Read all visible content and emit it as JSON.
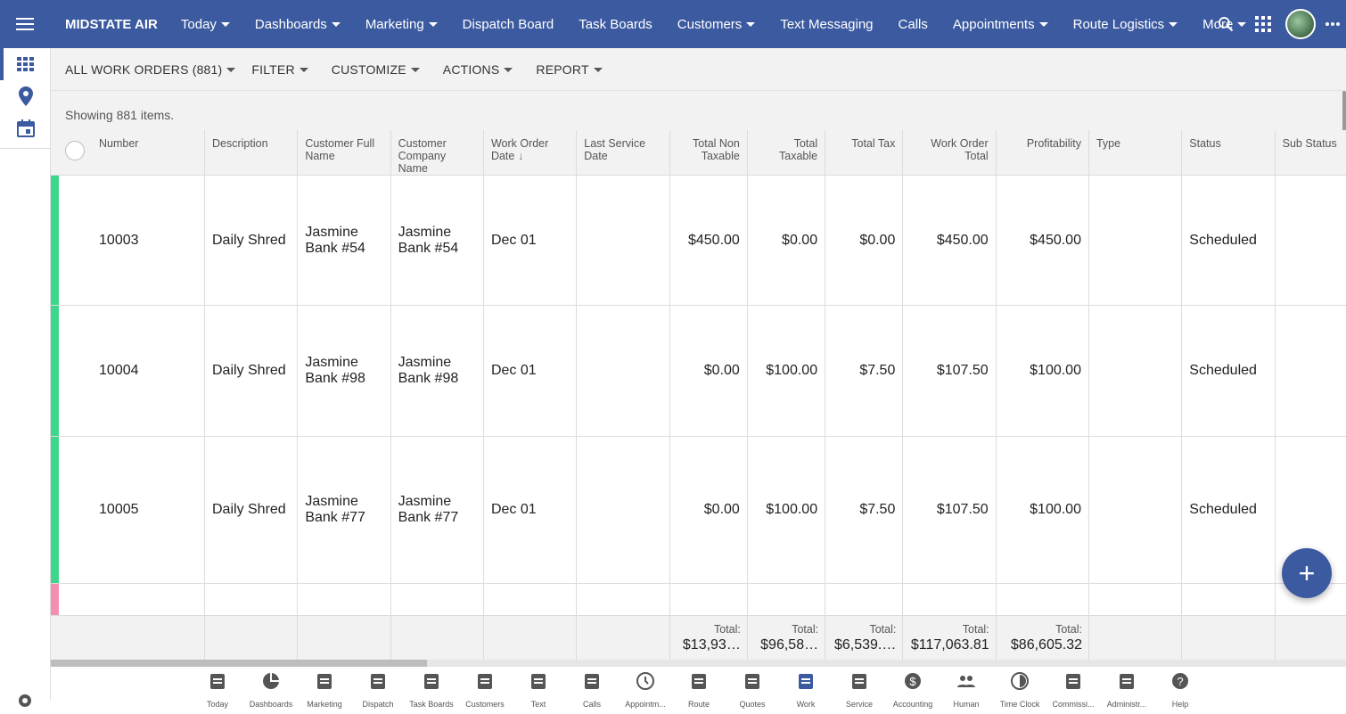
{
  "brand": "MIDSTATE AIR",
  "nav": [
    {
      "label": "Today",
      "caret": true
    },
    {
      "label": "Dashboards",
      "caret": true
    },
    {
      "label": "Marketing",
      "caret": true
    },
    {
      "label": "Dispatch Board",
      "caret": false
    },
    {
      "label": "Task Boards",
      "caret": false
    },
    {
      "label": "Customers",
      "caret": true
    },
    {
      "label": "Text Messaging",
      "caret": false
    },
    {
      "label": "Calls",
      "caret": false
    },
    {
      "label": "Appointments",
      "caret": true
    },
    {
      "label": "Route Logistics",
      "caret": true
    },
    {
      "label": "More",
      "caret": true
    }
  ],
  "nav_icons": [
    "search-icon",
    "apps-grid-icon",
    "avatar",
    "more-horizontal-icon"
  ],
  "rail_icons": [
    "grid-view-icon",
    "map-pin-icon",
    "calendar-icon"
  ],
  "toolbar": {
    "view": "ALL WORK ORDERS (881)",
    "filter": "FILTER",
    "customize": "CUSTOMIZE",
    "actions": "ACTIONS",
    "report": "REPORT"
  },
  "summary": "Showing 881 items.",
  "columns": [
    {
      "label": "Number",
      "align": "left"
    },
    {
      "label": "Description",
      "align": "left"
    },
    {
      "label": "Customer Full Name",
      "align": "left"
    },
    {
      "label": "Customer Company Name",
      "align": "left"
    },
    {
      "label": "Work Order Date",
      "align": "left",
      "sorted": "desc"
    },
    {
      "label": "Last Service Date",
      "align": "left"
    },
    {
      "label": "Total Non Taxable",
      "align": "right"
    },
    {
      "label": "Total Taxable",
      "align": "right"
    },
    {
      "label": "Total Tax",
      "align": "right"
    },
    {
      "label": "Work Order Total",
      "align": "right"
    },
    {
      "label": "Profitability",
      "align": "right"
    },
    {
      "label": "Type",
      "align": "left"
    },
    {
      "label": "Status",
      "align": "left"
    },
    {
      "label": "Sub Status",
      "align": "left"
    }
  ],
  "rows": [
    {
      "stripe": "#3dd68c",
      "cells": [
        "10003",
        "Daily Shred",
        "Jasmine Bank #54",
        "Jasmine Bank #54",
        "Dec 01",
        "",
        "$450.00",
        "$0.00",
        "$0.00",
        "$450.00",
        "$450.00",
        "",
        "Scheduled",
        ""
      ]
    },
    {
      "stripe": "#3dd68c",
      "cells": [
        "10004",
        "Daily Shred",
        "Jasmine Bank #98",
        "Jasmine Bank #98",
        "Dec 01",
        "",
        "$0.00",
        "$100.00",
        "$7.50",
        "$107.50",
        "$100.00",
        "",
        "Scheduled",
        ""
      ]
    },
    {
      "stripe": "#3dd68c",
      "cells": [
        "10005",
        "Daily Shred",
        "Jasmine Bank #77",
        "Jasmine Bank #77",
        "Dec 01",
        "",
        "$0.00",
        "$100.00",
        "$7.50",
        "$107.50",
        "$100.00",
        "",
        "Scheduled",
        ""
      ]
    },
    {
      "stripe": "#f48fb1",
      "cells": [
        "",
        "",
        "",
        "",
        "",
        "",
        "",
        "",
        "",
        "",
        "",
        "",
        "",
        ""
      ]
    }
  ],
  "totals": {
    "label": "Total:",
    "values": [
      "",
      "",
      "",
      "",
      "",
      "",
      "$13,93…",
      "$96,58…",
      "$6,539.…",
      "$117,063.81",
      "$86,605.32",
      "",
      "",
      ""
    ]
  },
  "dock": [
    {
      "icon": "today-icon",
      "label": "Today"
    },
    {
      "icon": "dashboards-icon",
      "label": "Dashboards"
    },
    {
      "icon": "marketing-icon",
      "label": "Marketing"
    },
    {
      "icon": "dispatch-icon",
      "label": "Dispatch"
    },
    {
      "icon": "task-boards-icon",
      "label": "Task Boards"
    },
    {
      "icon": "customers-icon",
      "label": "Customers"
    },
    {
      "icon": "text-icon",
      "label": "Text"
    },
    {
      "icon": "calls-icon",
      "label": "Calls"
    },
    {
      "icon": "appointments-icon",
      "label": "Appointm..."
    },
    {
      "icon": "route-icon",
      "label": "Route"
    },
    {
      "icon": "quotes-icon",
      "label": "Quotes"
    },
    {
      "icon": "work-icon",
      "label": "Work"
    },
    {
      "icon": "service-icon",
      "label": "Service"
    },
    {
      "icon": "accounting-icon",
      "label": "Accounting"
    },
    {
      "icon": "human-icon",
      "label": "Human"
    },
    {
      "icon": "time-clock-icon",
      "label": "Time Clock"
    },
    {
      "icon": "commissions-icon",
      "label": "Commissi..."
    },
    {
      "icon": "administration-icon",
      "label": "Administr..."
    },
    {
      "icon": "help-icon",
      "label": "Help"
    }
  ],
  "colors": {
    "primary": "#3b5aa0",
    "stripe_green": "#3dd68c",
    "stripe_pink": "#f48fb1",
    "header_bg": "#f2f2f2"
  }
}
